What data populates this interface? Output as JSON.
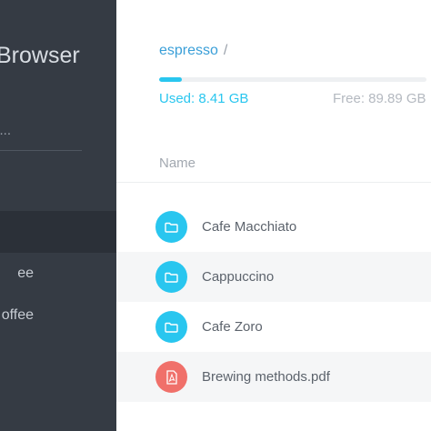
{
  "sidebar": {
    "app_title": "Browser",
    "search_placeholder": "s...",
    "items": [
      {
        "label": ""
      },
      {
        "label": "ee"
      },
      {
        "label": "offee"
      }
    ]
  },
  "main": {
    "breadcrumb": {
      "current": "espresso",
      "separator": "/"
    },
    "storage": {
      "used_label": "Used: 8.41 GB",
      "free_label": "Free: 89.89 GB",
      "used_fraction": 0.0856
    },
    "column_header": "Name",
    "files": [
      {
        "name": "Cafe Macchiato",
        "type": "folder",
        "icon": "folder-icon"
      },
      {
        "name": "Cappuccino",
        "type": "folder",
        "icon": "folder-icon"
      },
      {
        "name": "Cafe Zoro",
        "type": "folder",
        "icon": "folder-icon"
      },
      {
        "name": "Brewing methods.pdf",
        "type": "pdf",
        "icon": "pdf-file-icon"
      }
    ]
  },
  "colors": {
    "sidebar_bg": "#353b44",
    "accent": "#29c6ef",
    "link": "#3a9fd8",
    "pdf": "#f0706a"
  }
}
